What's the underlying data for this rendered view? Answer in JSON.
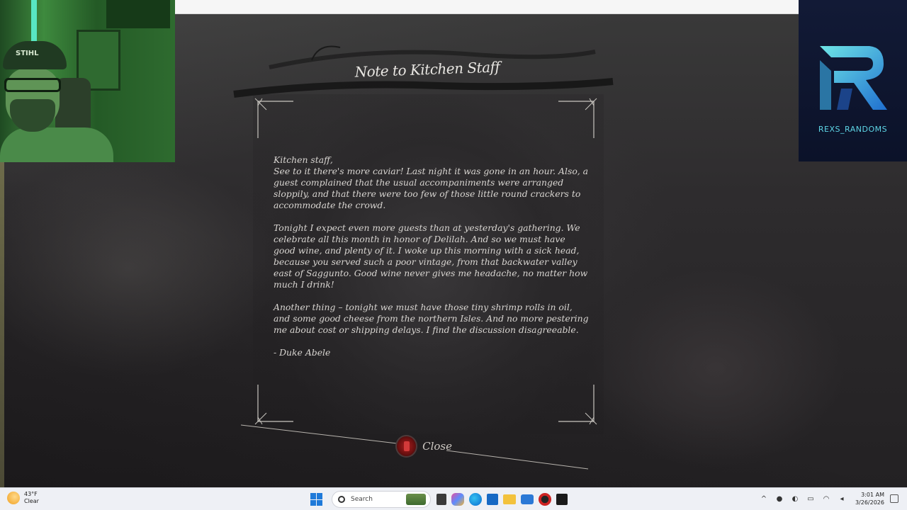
{
  "note": {
    "title": "Note to Kitchen Staff",
    "salutation": "Kitchen staff,",
    "paragraphs": [
      "See to it there's more caviar! Last night it was gone in an hour. Also, a guest complained that the usual accompaniments were arranged sloppily, and that there were too few of those little round crackers to accommodate the crowd.",
      "Tonight I expect even more guests than at yesterday's gathering. We celebrate all this month in honor of Delilah. And so we must have good wine, and plenty of it. I woke up this morning with a sick head, because you served such a poor vintage, from that backwater valley east of Saggunto. Good wine never gives me headache, no matter how much I drink!",
      "Another thing – tonight we must have those tiny shrimp rolls in oil, and some good cheese from the northern Isles. And no more pestering me about cost or shipping delays. I find the discussion disagreeable."
    ],
    "signature": "- Duke Abele",
    "close_label": "Close"
  },
  "webcam": {
    "cap_text": "STIHL"
  },
  "logo": {
    "channel_name": "REXS_RANDOMS",
    "colors": {
      "primary": "#5ed6e6",
      "secondary": "#2a7fd0",
      "background": "#0f1630"
    }
  },
  "taskbar": {
    "weather": {
      "temp": "43°F",
      "condition": "Clear",
      "icon": "moon-cloud-icon"
    },
    "search_placeholder": "Search",
    "apps": [
      "file-manager-icon",
      "copilot-icon",
      "edge-icon",
      "store-icon",
      "folder-icon",
      "mail-icon",
      "game-launcher-icon",
      "app-icon"
    ],
    "clock": {
      "time": "3:01 AM",
      "date": "3/26/2026"
    }
  }
}
